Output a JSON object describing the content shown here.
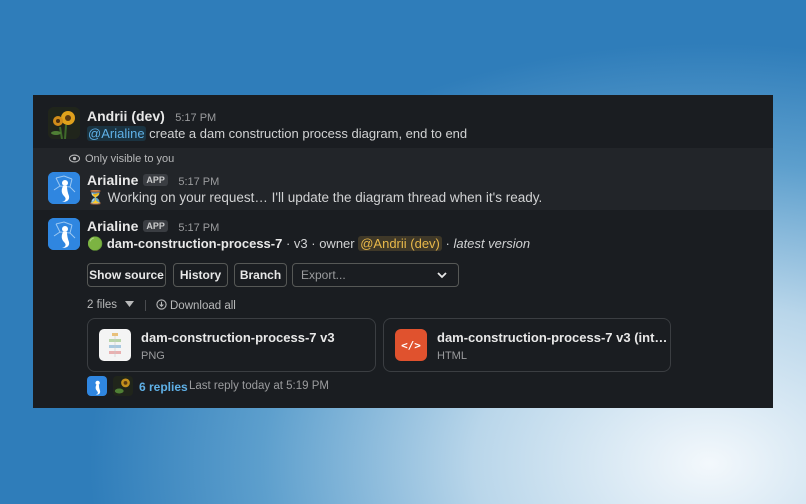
{
  "message1": {
    "author": "Andrii (dev)",
    "time": "5:17 PM",
    "mention": "@Arialine",
    "text": " create a dam construction process diagram, end to end"
  },
  "visibility_note": "Only visible to you",
  "message2": {
    "author": "Arialine",
    "badge": "APP",
    "time": "5:17 PM",
    "hourglass": "⏳",
    "text": "Working on your request… I'll update the diagram thread when it's ready."
  },
  "message3": {
    "author": "Arialine",
    "badge": "APP",
    "time": "5:17 PM",
    "status_circle": "🟢",
    "file_name": "dam-construction-process-7",
    "mid_text": " · v3 · owner ",
    "owner_mention": "@Andrii (dev)",
    "sep": " · ",
    "latest": "latest version",
    "buttons": {
      "show_source": "Show source",
      "history": "History",
      "branch": "Branch"
    },
    "export_placeholder": "Export...",
    "files_count": "2 files",
    "download_all": "Download all",
    "files": [
      {
        "title": "dam-construction-process-7 v3",
        "type": "PNG",
        "icon": "image-thumbnail-icon"
      },
      {
        "title": "dam-construction-process-7 v3 (int…",
        "type": "HTML",
        "icon": "code-icon",
        "icon_glyph": "</>"
      }
    ],
    "replies": "6 replies",
    "last_reply": "Last reply today at 5:19 PM"
  },
  "colors": {
    "panel_bg": "#1a1d21",
    "link": "#5fb0e6",
    "mention_yellow": "#e8b84a",
    "html_icon_bg": "#e0522e"
  }
}
